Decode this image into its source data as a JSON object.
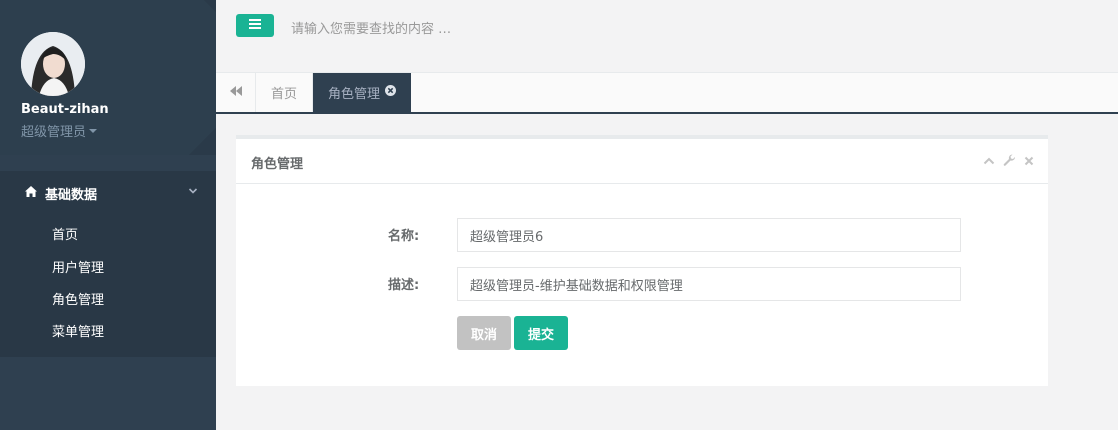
{
  "sidebar": {
    "profile": {
      "username": "Beaut-zihan",
      "role": "超级管理员"
    },
    "group": {
      "label": "基础数据",
      "items": [
        {
          "label": "首页"
        },
        {
          "label": "用户管理"
        },
        {
          "label": "角色管理"
        },
        {
          "label": "菜单管理"
        }
      ]
    }
  },
  "header": {
    "search_placeholder": "请输入您需要查找的内容 …"
  },
  "tabs": [
    {
      "label": "首页"
    },
    {
      "label": "角色管理"
    }
  ],
  "panel": {
    "title": "角色管理",
    "form": {
      "name_label": "名称:",
      "name_value": "超级管理员6",
      "desc_label": "描述:",
      "desc_value": "超级管理员-维护基础数据和权限管理",
      "cancel_label": "取消",
      "submit_label": "提交"
    }
  },
  "colors": {
    "accent": "#1ab394",
    "sidebar": "#2f4050"
  }
}
